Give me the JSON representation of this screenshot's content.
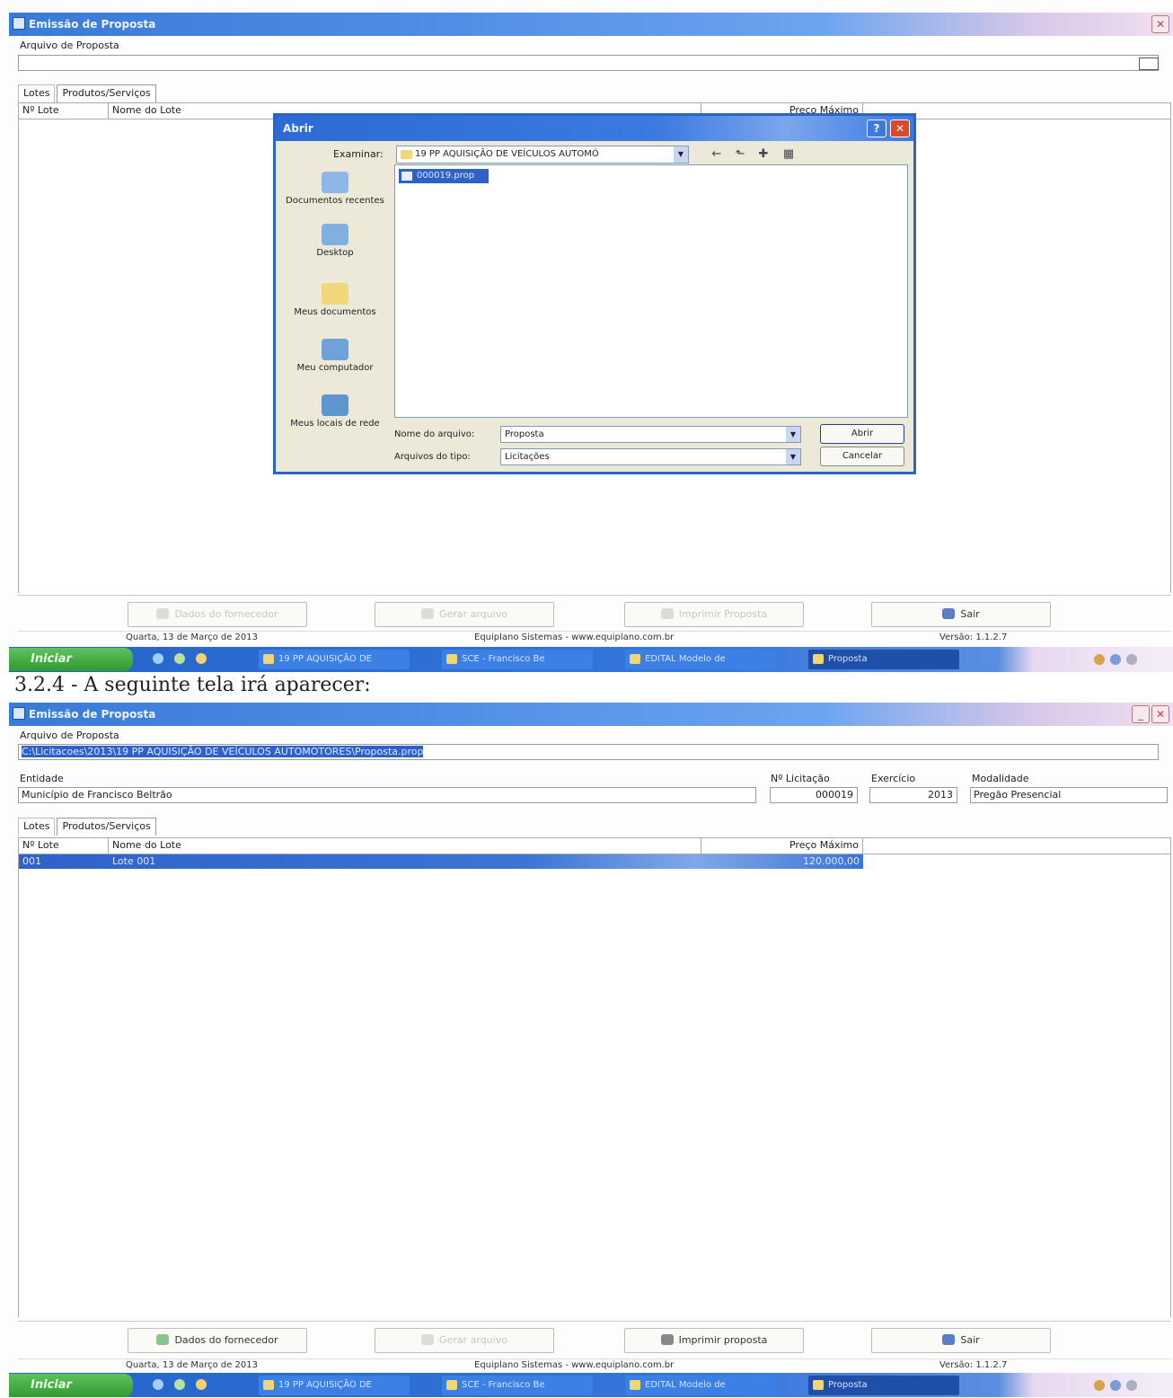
{
  "top_window": {
    "title": "Emissão de Proposta",
    "file_label": "Arquivo de Proposta",
    "file_value": "",
    "tabs": [
      "Lotes",
      "Produtos/Serviços"
    ],
    "grid_headers": [
      "Nº Lote",
      "Nome do Lote",
      "Preço Máximo"
    ],
    "buttons": [
      "Dados do fornecedor",
      "Gerar arquivo",
      "Imprimir Proposta",
      "Sair"
    ],
    "status": {
      "date": "Quarta, 13 de Março de 2013",
      "company": "Equiplano Sistemas - www.equiplano.com.br",
      "version": "Versão: 1.1.2.7"
    }
  },
  "dialog": {
    "title": "Abrir",
    "lookin_label": "Examinar:",
    "lookin_value": "19 PP AQUISIÇÃO DE VEÍCULOS AUTOMÓ",
    "places": [
      "Documentos recentes",
      "Desktop",
      "Meus documentos",
      "Meu computador",
      "Meus locais de rede"
    ],
    "file_item": "000019.prop",
    "filename_label": "Nome do arquivo:",
    "filename_value": "Proposta",
    "filetype_label": "Arquivos do tipo:",
    "filetype_value": "Licitações",
    "open_button": "Abrir",
    "cancel_button": "Cancelar"
  },
  "heading": "3.2.4 - A seguinte tela irá aparecer:",
  "bottom_window": {
    "title": "Emissão de Proposta",
    "file_label": "Arquivo de Proposta",
    "file_value": "C:\\Licitacoes\\2013\\19 PP AQUISIÇÃO DE VEÍCULOS AUTOMOTORES\\Proposta.prop",
    "entidade_label": "Entidade",
    "entidade_value": "Município de Francisco Beltrão",
    "licitacao_label": "Nº Licitação",
    "licitacao_value": "000019",
    "exercicio_label": "Exercício",
    "exercicio_value": "2013",
    "modalidade_label": "Modalidade",
    "modalidade_value": "Pregão Presencial",
    "tabs": [
      "Lotes",
      "Produtos/Serviços"
    ],
    "grid_headers": [
      "Nº Lote",
      "Nome do Lote",
      "Preço Máximo"
    ],
    "row": {
      "lote": "001",
      "nome": "Lote 001",
      "preco": "120.000,00"
    },
    "buttons": [
      "Dados do fornecedor",
      "Gerar arquivo",
      "Imprimir proposta",
      "Sair"
    ],
    "status": {
      "date": "Quarta, 13 de Março de 2013",
      "company": "Equiplano Sistemas - www.equiplano.com.br",
      "version": "Versão: 1.1.2.7"
    }
  },
  "taskbar": {
    "start": "Iniciar",
    "items_top": [
      "19 PP AQUISIÇÃO DE",
      "SCE - Francisco Be",
      "EDITAL Modelo de",
      "Proposta"
    ],
    "items_bottom": [
      "19 PP AQUISIÇÃO DE",
      "SCE - Francisco Be",
      "EDITAL Modelo de",
      "Proposta"
    ]
  }
}
